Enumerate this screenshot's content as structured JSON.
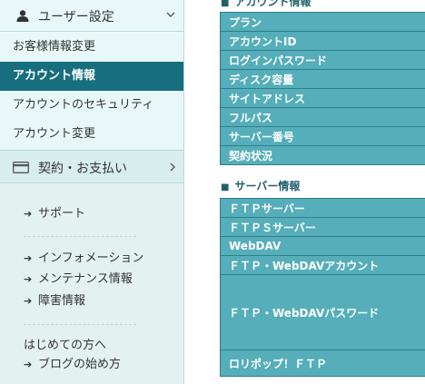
{
  "sidebar": {
    "user_settings_title": "ユーザー設定",
    "user_items": [
      {
        "label": "お客様情報変更"
      },
      {
        "label": "アカウント情報",
        "active": true
      },
      {
        "label": "アカウントのセキュリティ"
      },
      {
        "label": "アカウント変更"
      }
    ],
    "billing_title": "契約・お支払い",
    "support_label": "サポート",
    "info_label": "インフォメーション",
    "maintenance_label": "メンテナンス情報",
    "incident_label": "障害情報",
    "beginners_label": "はじめての方へ",
    "blog_start_label": "ブログの始め方"
  },
  "main": {
    "account_section_title": "アカウント情報",
    "account_rows": [
      "プラン",
      "アカウントID",
      "ログインパスワード",
      "ディスク容量",
      "サイトアドレス",
      "フルパス",
      "サーバー番号",
      "契約状況"
    ],
    "server_section_title": "サーバー情報",
    "server_rows": [
      "ＦＴＰサーバー",
      "ＦＴＰＳサーバー",
      "WebDAV",
      "ＦＴＰ・WebDAVアカウント",
      "ＦＴＰ・WebDAVパスワード",
      "ロリポップ！ＦＴＰ"
    ]
  },
  "colors": {
    "active_item": "#176e7e",
    "table_cell": "#55aeb9",
    "sidebar_bg": "#e8f8f8"
  },
  "icons": {
    "user": "user-icon",
    "card": "credit-card-icon",
    "chevron_down": "chevron-down-icon",
    "chevron_right": "chevron-right-icon",
    "arrow": "arrow-right-icon"
  }
}
